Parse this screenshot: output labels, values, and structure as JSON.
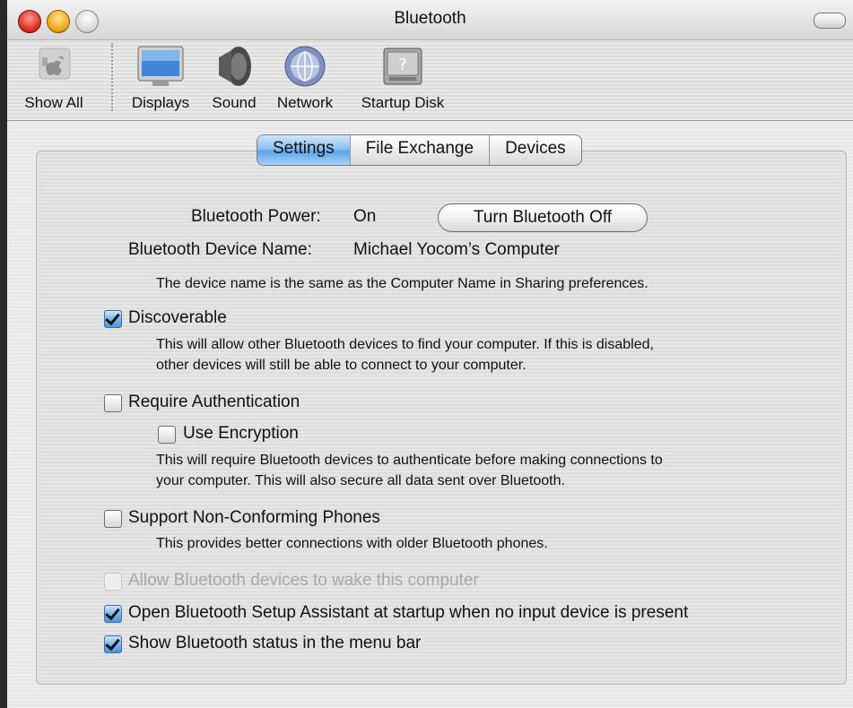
{
  "window": {
    "title": "Bluetooth"
  },
  "toolbar": {
    "items": [
      {
        "label": "Show All",
        "icon": "apple-icon"
      },
      {
        "label": "Displays",
        "icon": "display-icon"
      },
      {
        "label": "Sound",
        "icon": "speaker-icon"
      },
      {
        "label": "Network",
        "icon": "network-globe-icon"
      },
      {
        "label": "Startup Disk",
        "icon": "startup-disk-icon"
      }
    ]
  },
  "tabs": [
    {
      "label": "Settings",
      "active": true
    },
    {
      "label": "File Exchange",
      "active": false
    },
    {
      "label": "Devices",
      "active": false
    }
  ],
  "settings": {
    "power_label": "Bluetooth Power:",
    "power_value": "On",
    "power_button": "Turn Bluetooth Off",
    "device_name_label": "Bluetooth Device Name:",
    "device_name_value": "Michael Yocom’s Computer",
    "device_name_note": "The device name is the same as the Computer Name in Sharing preferences.",
    "discoverable": {
      "label": "Discoverable",
      "checked": true,
      "note_line1": "This will allow other Bluetooth devices to find your computer.  If this is disabled,",
      "note_line2": "other devices will still be able to connect to your computer."
    },
    "require_auth": {
      "label": "Require Authentication",
      "checked": false
    },
    "use_encryption": {
      "label": "Use Encryption",
      "checked": false,
      "note_line1": "This will require Bluetooth devices to authenticate before making connections to",
      "note_line2": "your computer. This will also secure all data sent over Bluetooth."
    },
    "non_conforming": {
      "label": "Support Non-Conforming Phones",
      "checked": false,
      "note": "This provides better connections with older Bluetooth phones."
    },
    "allow_wake": {
      "label": "Allow Bluetooth devices to wake this computer",
      "checked": false,
      "enabled": false
    },
    "setup_assistant": {
      "label": "Open Bluetooth Setup Assistant at startup when no input device is present",
      "checked": true
    },
    "status_menu": {
      "label": "Show Bluetooth status in the menu bar",
      "checked": true
    }
  }
}
